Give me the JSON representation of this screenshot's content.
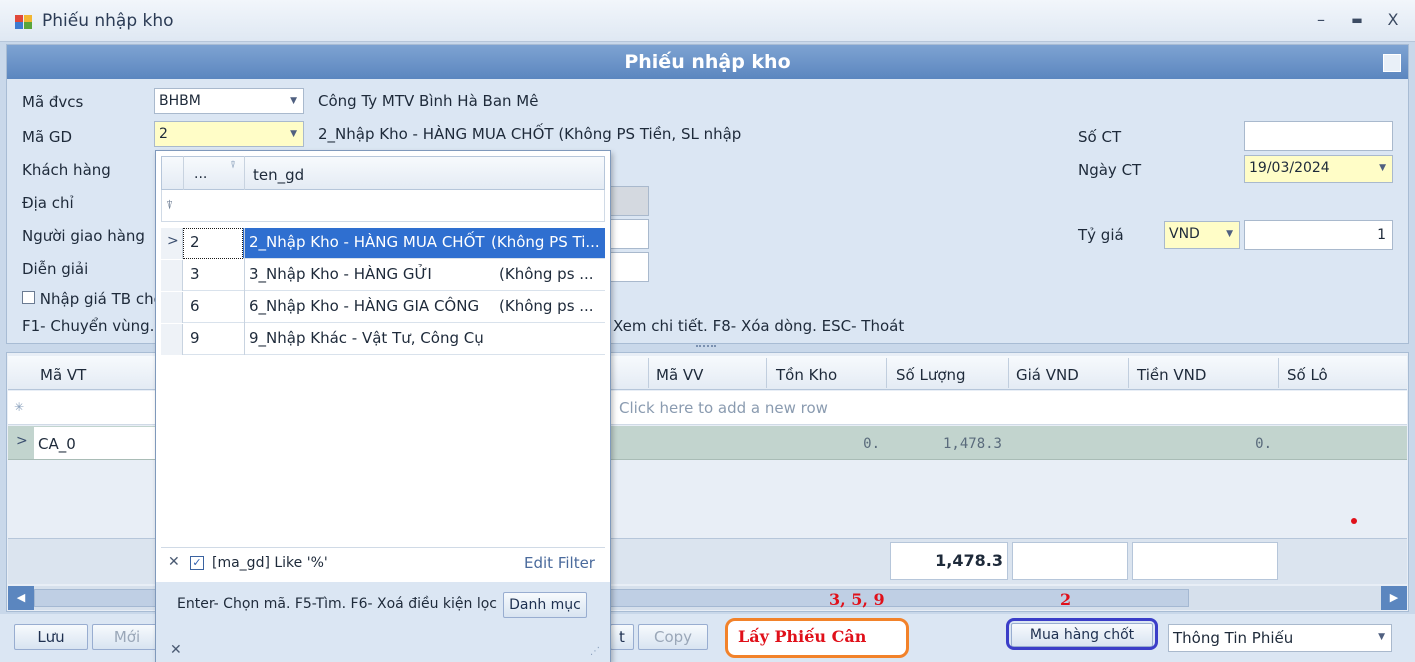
{
  "window": {
    "title": "Phiếu nhập kho",
    "minimize": "–",
    "maximize": "▬",
    "close": "X"
  },
  "form": {
    "header": "Phiếu nhập kho",
    "ma_dvcs_label": "Mã đvcs",
    "ma_dvcs_value": "BHBM",
    "ma_dvcs_desc": "Công Ty MTV Bình Hà Ban Mê",
    "ma_gd_label": "Mã GD",
    "ma_gd_value": "2",
    "ma_gd_desc": "2_Nhập Kho - HÀNG MUA CHỐT   (Không PS Tiền, SL nhập",
    "khach_hang_label": "Khách hàng",
    "dia_chi_label": "Địa chỉ",
    "nguoi_giao_hang_label": "Người giao hàng",
    "dien_giai_label": "Diễn giải",
    "nhap_gia_label": "Nhập giá TB cho",
    "hotkeys_left": "F1- Chuyển vùng.",
    "hotkeys_right": "Xem chi tiết. F8- Xóa dòng. ESC- Thoát",
    "so_ct_label": "Số CT",
    "so_ct_value": "",
    "ngay_ct_label": "Ngày CT",
    "ngay_ct_value": "19/03/2024",
    "ty_gia_label": "Tỷ giá",
    "currency": "VND",
    "rate": "1"
  },
  "grid": {
    "columns": [
      "Mã VT",
      "Mã VV",
      "Tồn Kho",
      "Số Lượng",
      "Giá VND",
      "Tiền VND",
      "Số Lô"
    ],
    "new_row_hint": "Click here to add a new row",
    "row": {
      "ma_vt": "CA_0",
      "ton_kho": "0.",
      "so_luong": "1,478.3",
      "tien_vnd": "0."
    },
    "total_so_luong": "1,478.3"
  },
  "dropdown": {
    "col1_header": "...",
    "col2_header": "ten_gd",
    "rows": [
      {
        "code": "2",
        "name": "2_Nhập Kho - HÀNG MUA CHỐT",
        "note": "(Không PS Ti..."
      },
      {
        "code": "3",
        "name": "3_Nhập Kho - HÀNG GỬI",
        "note": "(Không ps ..."
      },
      {
        "code": "6",
        "name": "6_Nhập Kho - HÀNG GIA CÔNG",
        "note": "(Không ps ..."
      },
      {
        "code": "9",
        "name": "9_Nhập Khác - Vật Tư, Công Cụ",
        "note": ""
      }
    ],
    "filter_text": "[ma_gd] Like '%'",
    "edit_filter": "Edit Filter",
    "hint": "Enter- Chọn mã. F5-Tìm. F6- Xoá điều kiện lọc",
    "danh_muc": "Danh mục"
  },
  "buttons": {
    "luu": "Lưu",
    "moi": "Mới",
    "t_partial": "t",
    "copy": "Copy",
    "lay_phieu_can": "Lấy Phiếu Cân",
    "mua_hang_chot": "Mua hàng chốt",
    "thong_tin_phieu": "Thông Tin Phiếu"
  },
  "annotations": {
    "left": "3, 5, 9",
    "right": "2"
  },
  "colors": {
    "header": "#5b86bf",
    "selected_row": "#2f6fd0",
    "highlight_orange": "#f2822a",
    "highlight_blue": "#3b3ec8",
    "annot_red": "#e0101a"
  }
}
